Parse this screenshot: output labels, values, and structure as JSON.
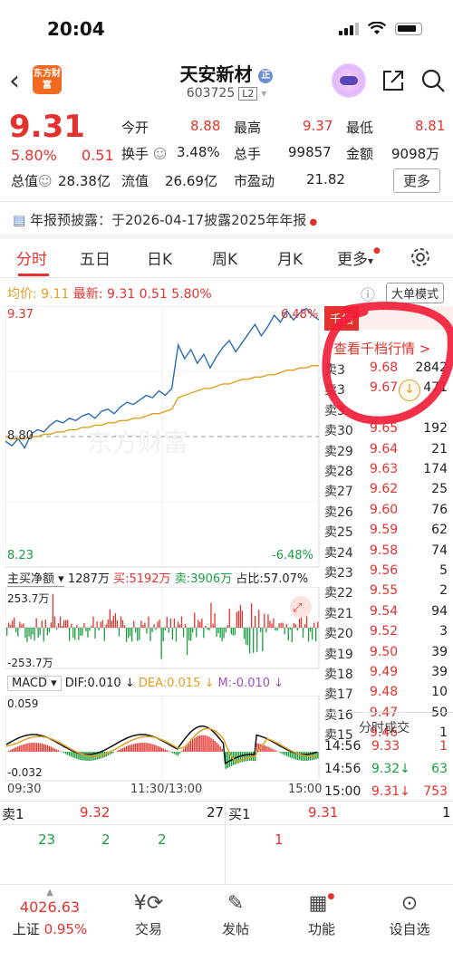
{
  "status_bar": {
    "time": "20:04"
  },
  "header": {
    "logo_text": "东方财富",
    "stock_name": "天安新材",
    "stock_code": "603725",
    "level_badge": "L2"
  },
  "quote": {
    "price": "9.31",
    "change_pct": "5.80%",
    "change": "0.51",
    "open_label": "今开",
    "open": "8.88",
    "high_label": "最高",
    "high": "9.37",
    "low_label": "最低",
    "low": "8.81",
    "turnover_label": "换手",
    "turnover": "3.48%",
    "volume_label": "总手",
    "volume": "99857",
    "amount_label": "金额",
    "amount": "9098万",
    "mktcap_label": "总值",
    "mktcap": "28.38亿",
    "float_label": "流值",
    "float": "26.69亿",
    "pe_label": "市盈动",
    "pe": "21.82",
    "more_label": "更多"
  },
  "notice": "年报预披露：于2026-04-17披露2025年年报",
  "tabs": [
    "分时",
    "五日",
    "日K",
    "周K",
    "月K",
    "更多"
  ],
  "chart_header": {
    "avg_label": "均价:",
    "avg": "9.11",
    "latest_label": "最新:",
    "latest": "9.31",
    "chg": "0.51",
    "pct": "5.80%",
    "big_order_mode": "大单模式"
  },
  "chart_data": [
    {
      "type": "line",
      "title": "分时",
      "y_top_label": "9.37",
      "y_bottom_label": "8.23",
      "y_mid_label": "8.80",
      "right_top_label": "6.48%",
      "right_bottom_label": "-6.48%",
      "ylim": [
        8.23,
        9.37
      ],
      "series": [
        {
          "name": "price",
          "color": "#2a6db5",
          "values": [
            8.78,
            8.76,
            8.79,
            8.75,
            8.81,
            8.83,
            8.82,
            8.85,
            8.87,
            8.86,
            8.88,
            8.87,
            8.89,
            8.9,
            8.88,
            8.91,
            8.92,
            8.9,
            8.93,
            8.95,
            8.94,
            8.96,
            8.98,
            8.97,
            9.0,
            8.98,
            9.01,
            9.2,
            9.14,
            9.18,
            9.12,
            9.16,
            9.1,
            9.15,
            9.19,
            9.22,
            9.17,
            9.21,
            9.25,
            9.29,
            9.24,
            9.28,
            9.33,
            9.3,
            9.35,
            9.31,
            9.34,
            9.36,
            9.33,
            9.31
          ]
        },
        {
          "name": "avg",
          "color": "#e0a020",
          "values": [
            8.8,
            8.79,
            8.79,
            8.79,
            8.8,
            8.8,
            8.81,
            8.81,
            8.82,
            8.82,
            8.83,
            8.83,
            8.84,
            8.84,
            8.85,
            8.85,
            8.86,
            8.86,
            8.87,
            8.87,
            8.88,
            8.88,
            8.89,
            8.9,
            8.9,
            8.91,
            8.92,
            8.97,
            8.98,
            8.99,
            9.0,
            9.01,
            9.01,
            9.02,
            9.03,
            9.03,
            9.04,
            9.05,
            9.05,
            9.06,
            9.06,
            9.07,
            9.07,
            9.08,
            9.09,
            9.09,
            9.1,
            9.1,
            9.11,
            9.11
          ]
        }
      ]
    },
    {
      "type": "bar",
      "title": "主买净额",
      "header_values": {
        "net": "1287万",
        "buy_label": "买:",
        "buy": "5192万",
        "sell_label": "卖:",
        "sell": "3906万",
        "ratio_label": "占比:",
        "ratio": "57.07%"
      },
      "y_top_label": "253.7万",
      "y_bottom_label": "-253.7万",
      "ylim": [
        -253.7,
        253.7
      ]
    },
    {
      "type": "bar",
      "title": "MACD",
      "header_values": {
        "dif": "DIF:0.010 ↓",
        "dea": "DEA:0.015 ↓",
        "m": "M:-0.010 ↓"
      },
      "y_top_label": "0.059",
      "y_bottom_label": "-0.032",
      "x_labels": [
        "09:30",
        "11:30/13:00",
        "15:00"
      ]
    }
  ],
  "order_book": {
    "tab_label": "千档",
    "view_link": "查看千档行情 >",
    "asks": [
      {
        "label": "卖3",
        "price": "9.68",
        "vol": "2842"
      },
      {
        "label": "卖3",
        "price": "9.67",
        "vol": "471"
      },
      {
        "label": "卖3",
        "price": "",
        "vol": ""
      },
      {
        "label": "卖30",
        "price": "9.65",
        "vol": "192"
      },
      {
        "label": "卖29",
        "price": "9.64",
        "vol": "21"
      },
      {
        "label": "卖28",
        "price": "9.63",
        "vol": "174"
      },
      {
        "label": "卖27",
        "price": "9.62",
        "vol": "25"
      },
      {
        "label": "卖26",
        "price": "9.60",
        "vol": "76"
      },
      {
        "label": "卖25",
        "price": "9.59",
        "vol": "62"
      },
      {
        "label": "卖24",
        "price": "9.58",
        "vol": "74"
      },
      {
        "label": "卖23",
        "price": "9.56",
        "vol": "5"
      },
      {
        "label": "卖22",
        "price": "9.55",
        "vol": "2"
      },
      {
        "label": "卖21",
        "price": "9.54",
        "vol": "94"
      },
      {
        "label": "卖20",
        "price": "9.52",
        "vol": "3"
      },
      {
        "label": "卖19",
        "price": "9.50",
        "vol": "39"
      },
      {
        "label": "卖18",
        "price": "9.49",
        "vol": "39"
      },
      {
        "label": "卖17",
        "price": "9.48",
        "vol": "10"
      },
      {
        "label": "卖16",
        "price": "9.47",
        "vol": "50"
      },
      {
        "label": "卖15",
        "price": "9.46",
        "vol": "1"
      }
    ],
    "trades_title": "分时成交",
    "trades": [
      {
        "time": "14:56",
        "price": "9.33",
        "vol": "1",
        "color": "#e5322d"
      },
      {
        "time": "14:56",
        "price": "9.32↓",
        "vol": "63",
        "color": "#1a9e3f"
      },
      {
        "time": "15:00",
        "price": "9.31↓",
        "vol": "753",
        "color": "#e5322d"
      }
    ]
  },
  "level1": {
    "sell_label": "卖1",
    "sell_price": "9.32",
    "sell_vol": "27",
    "buy_label": "买1",
    "buy_price": "9.31",
    "buy_vol": "1",
    "sell_orders": [
      "23",
      "2",
      "2"
    ],
    "buy_orders": [
      "1"
    ]
  },
  "tabbar": {
    "index_value": "4026.63",
    "index_name": "上证",
    "index_pct": "0.95%",
    "items": [
      "交易",
      "发帖",
      "功能",
      "设自选"
    ]
  },
  "watermark": "东方财富"
}
